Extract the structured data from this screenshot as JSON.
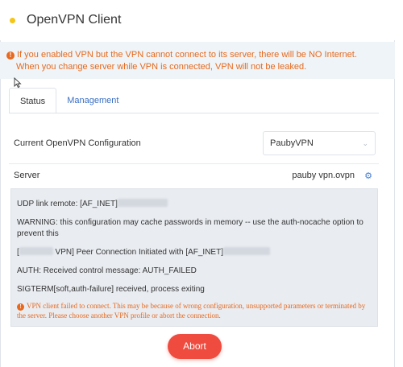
{
  "header": {
    "title": "OpenVPN Client",
    "status_color": "#f5c518"
  },
  "warning": {
    "line1": "If you enabled VPN but the VPN cannot connect to its server, there will be NO Internet.",
    "line2": "When you change server while VPN is connected, VPN will not be leaked.",
    "icon": "exclamation-circle-icon",
    "color": "#e8691d"
  },
  "tabs": [
    {
      "label": "Status",
      "active": true
    },
    {
      "label": "Management",
      "active": false
    }
  ],
  "config": {
    "label": "Current OpenVPN Configuration",
    "selected": "PaubyVPN"
  },
  "server": {
    "label": "Server",
    "value": "pauby vpn.ovpn",
    "icon": "gear-icon"
  },
  "log": {
    "udp": "UDP link remote: [AF_INET]",
    "warning": "WARNING: this configuration may cache passwords in memory -- use the auth-nocache option to prevent this",
    "peer_prefix": "[",
    "peer_mid": " VPN] Peer Connection Initiated with [AF_INET]",
    "auth": "AUTH: Received control message: AUTH_FAILED",
    "sigterm": "SIGTERM[soft,auth-failure] received, process exiting",
    "error": "VPN client failed to connect. This may be because of wrong configuration, unsupported parameters or terminated by the server. Please choose another VPN profile or abort the connection."
  },
  "abort_button": {
    "label": "Abort",
    "color": "#f04b3f"
  }
}
